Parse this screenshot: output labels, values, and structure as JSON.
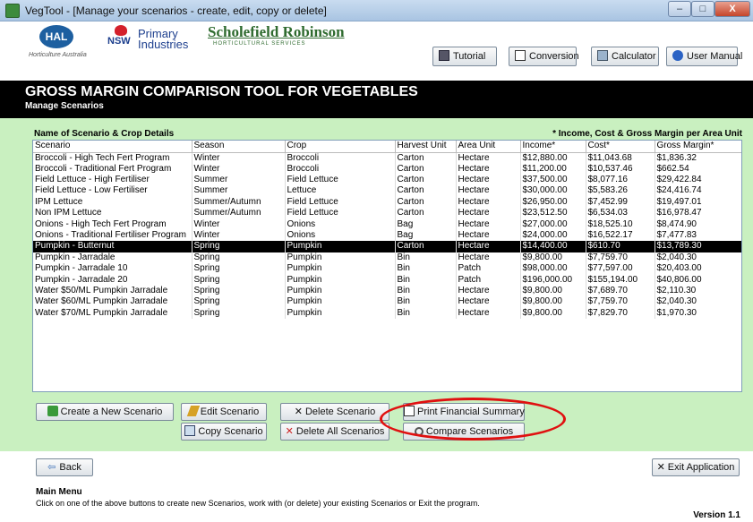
{
  "window": {
    "title": "VegTool - [Manage your scenarios - create, edit, copy or delete]",
    "minimize": "–",
    "maximize": "□",
    "close": "X"
  },
  "logos": {
    "hal": "HAL",
    "hal_sub": "Horticulture Australia",
    "nsw": "NSW",
    "primary_industries": "Primary Industries",
    "scholefield": "Scholefield Robinson",
    "scholefield_sub": "HORTICULTURAL SERVICES"
  },
  "toolbar": {
    "tutorial": "Tutorial",
    "conversion": "Conversion",
    "calculator": "Calculator",
    "user_manual": "User Manual"
  },
  "band": {
    "title": "GROSS MARGIN COMPARISON TOOL FOR VEGETABLES",
    "subtitle": "Manage Scenarios"
  },
  "list": {
    "label": "Name of Scenario & Crop Details",
    "note": "* Income, Cost & Gross Margin per Area Unit",
    "columns": [
      "Scenario",
      "Season",
      "Crop",
      "Harvest Unit",
      "Area Unit",
      "Income*",
      "Cost*",
      "Gross Margin*"
    ],
    "rows": [
      [
        "Broccoli - High Tech Fert Program",
        "Winter",
        "Broccoli",
        "Carton",
        "Hectare",
        "$12,880.00",
        "$11,043.68",
        "$1,836.32"
      ],
      [
        "Broccoli - Traditional Fert Program",
        "Winter",
        "Broccoli",
        "Carton",
        "Hectare",
        "$11,200.00",
        "$10,537.46",
        "$662.54"
      ],
      [
        "Field Lettuce - High Fertiliser",
        "Summer",
        "Field Lettuce",
        "Carton",
        "Hectare",
        "$37,500.00",
        "$8,077.16",
        "$29,422.84"
      ],
      [
        "Field Lettuce - Low Fertiliser",
        "Summer",
        "Lettuce",
        "Carton",
        "Hectare",
        "$30,000.00",
        "$5,583.26",
        "$24,416.74"
      ],
      [
        "IPM Lettuce",
        "Summer/Autumn",
        "Field Lettuce",
        "Carton",
        "Hectare",
        "$26,950.00",
        "$7,452.99",
        "$19,497.01"
      ],
      [
        "Non IPM Lettuce",
        "Summer/Autumn",
        "Field Lettuce",
        "Carton",
        "Hectare",
        "$23,512.50",
        "$6,534.03",
        "$16,978.47"
      ],
      [
        "Onions - High Tech Fert Program",
        "Winter",
        "Onions",
        "Bag",
        "Hectare",
        "$27,000.00",
        "$18,525.10",
        "$8,474.90"
      ],
      [
        "Onions - Traditional Fertiliser Program",
        "Winter",
        "Onions",
        "Bag",
        "Hectare",
        "$24,000.00",
        "$16,522.17",
        "$7,477.83"
      ],
      [
        "Pumpkin - Butternut",
        "Spring",
        "Pumpkin",
        "Carton",
        "Hectare",
        "$14,400.00",
        "$610.70",
        "$13,789.30"
      ],
      [
        "Pumpkin - Jarradale",
        "Spring",
        "Pumpkin",
        "Bin",
        "Hectare",
        "$9,800.00",
        "$7,759.70",
        "$2,040.30"
      ],
      [
        "Pumpkin - Jarradale 10",
        "Spring",
        "Pumpkin",
        "Bin",
        "Patch",
        "$98,000.00",
        "$77,597.00",
        "$20,403.00"
      ],
      [
        "Pumpkin - Jarradale 20",
        "Spring",
        "Pumpkin",
        "Bin",
        "Patch",
        "$196,000.00",
        "$155,194.00",
        "$40,806.00"
      ],
      [
        "Water $50/ML Pumpkin Jarradale",
        "Spring",
        "Pumpkin",
        "Bin",
        "Hectare",
        "$9,800.00",
        "$7,689.70",
        "$2,110.30"
      ],
      [
        "Water $60/ML Pumpkin Jarradale",
        "Spring",
        "Pumpkin",
        "Bin",
        "Hectare",
        "$9,800.00",
        "$7,759.70",
        "$2,040.30"
      ],
      [
        "Water $70/ML Pumpkin Jarradale",
        "Spring",
        "Pumpkin",
        "Bin",
        "Hectare",
        "$9,800.00",
        "$7,829.70",
        "$1,970.30"
      ]
    ],
    "selected_row": 8
  },
  "actions": {
    "create": "Create a New Scenario",
    "edit": "Edit Scenario",
    "delete": "Delete  Scenario",
    "print": "Print Financial Summary",
    "copy": "Copy Scenario",
    "delete_all": "Delete All Scenarios",
    "compare": "Compare Scenarios"
  },
  "footer": {
    "back": "Back",
    "exit": "Exit Application",
    "menu_title": "Main Menu",
    "menu_text": "Click on one of the above buttons to create new Scenarios, work with (or delete) your existing Scenarios or Exit the program.",
    "version": "Version 1.1"
  },
  "colors": {
    "panel": "#c9f0c0",
    "band": "#000000",
    "highlight": "#e01010"
  }
}
